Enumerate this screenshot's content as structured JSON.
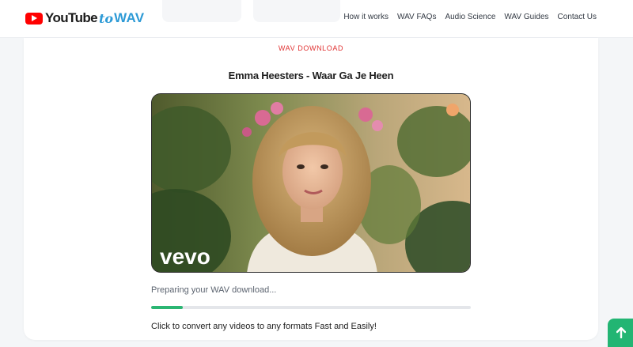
{
  "header": {
    "logo": {
      "part1": "YouTube",
      "part2": "to",
      "part3": "WAV",
      "icon": "youtube-play-icon"
    },
    "nav": [
      {
        "label": "How it works"
      },
      {
        "label": "WAV FAQs"
      },
      {
        "label": "Audio Science"
      },
      {
        "label": "WAV Guides"
      },
      {
        "label": "Contact Us"
      }
    ]
  },
  "main": {
    "eyebrow": "WAV DOWNLOAD",
    "video_title": "Emma Heesters - Waar Ga Je Heen",
    "thumbnail": {
      "watermark": "vevo"
    },
    "status": "Preparing your WAV download...",
    "progress_percent": 10,
    "cta": "Click to convert any videos to any formats Fast and Easily!"
  },
  "scroll_top": {
    "icon": "arrow-up-icon"
  },
  "colors": {
    "accent_green": "#22b573",
    "eyebrow_red": "#e03131",
    "brand_blue": "#2d9ad6",
    "youtube_red": "#ff0000"
  }
}
